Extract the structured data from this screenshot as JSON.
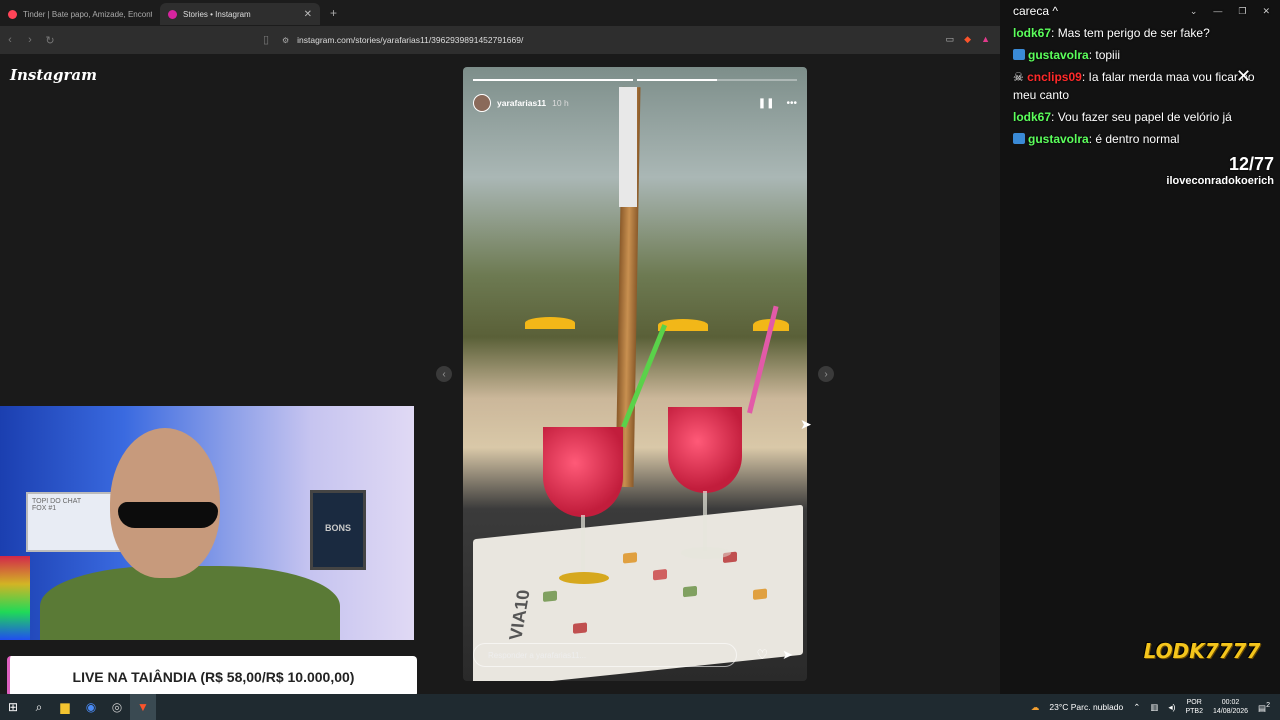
{
  "browser": {
    "tabs": [
      {
        "label": "Tinder | Bate papo, Amizade, Encontros",
        "favicon_color": "#ff4458",
        "active": false
      },
      {
        "label": "Stories • Instagram",
        "favicon_color": "#d6249f",
        "active": true
      }
    ],
    "new_tab": "+",
    "url": "instagram.com/stories/yarafarias11/3962939891452791669/"
  },
  "instagram": {
    "logo": "Instagram",
    "story": {
      "username": "yarafarias11",
      "time": "10 h",
      "reply_placeholder": "Responder a yarafarias11...",
      "progress_segments": [
        1.0,
        0.5
      ],
      "menu_title": "VIA10"
    }
  },
  "webcam": {
    "whiteboard_text": "TOPI DO CHAT\nFOX #1",
    "poster_text": "BONS"
  },
  "live_banner": "LIVE NA TAIÂNDIA (R$ 58,00/R$ 10.000,00)",
  "chat": {
    "title": "careca ^",
    "messages": [
      {
        "user": "lodk67",
        "color": "#5cff5c",
        "badge": "",
        "text": "Mas tem perigo de ser fake?"
      },
      {
        "user": "gustavolra",
        "color": "#5cff5c",
        "badge": "#3a8ad6",
        "text": "topiii"
      },
      {
        "user": "cnclips09",
        "color": "#ff2a2a",
        "badge": "skull",
        "text": "Ia falar merda maa vou ficar no meu canto"
      },
      {
        "user": "lodk67",
        "color": "#5cff5c",
        "badge": "",
        "text": "Vou fazer seu papel de velório já"
      },
      {
        "user": "gustavolra",
        "color": "#5cff5c",
        "badge": "#3a8ad6",
        "text": "é dentro normal"
      }
    ],
    "counter": "12/77",
    "counter_user": "iloveconradokoerich",
    "logo": "LODK7777"
  },
  "taskbar": {
    "weather": "23°C  Parc. nublado",
    "lang": "POR\nPTB2",
    "time": "00:02",
    "date": "14/08/2026",
    "notif": "2"
  }
}
